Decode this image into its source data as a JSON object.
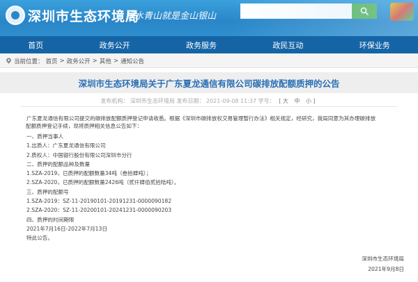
{
  "header": {
    "site_title": "深圳市生态环境局",
    "slogan": "绿水青山就是金山银山",
    "search_placeholder": "",
    "search_icon": "search-icon"
  },
  "nav": {
    "items": [
      {
        "label": "首页"
      },
      {
        "label": "政务公开"
      },
      {
        "label": "政务服务"
      },
      {
        "label": "政民互动"
      },
      {
        "label": "环保业务"
      }
    ]
  },
  "breadcrumb": {
    "prefix": "当前位置：",
    "items": [
      "首页",
      "政务公开",
      "其他",
      "通知公告"
    ],
    "sep": ">"
  },
  "article": {
    "title": "深圳市生态环境局关于广东夏龙通信有限公司碳排放配额质押的公告",
    "meta_text": "发布机构：  深圳市生态环境局  发布日期：  2021-09-08 11:37  字号：",
    "font_sizes": [
      "[ 大",
      "中",
      "小 ]"
    ],
    "intro_lines": [
      "广东夏龙通信有限公司提交的碳排放配额质押登记申请收悉。根据《深圳市碳排放权交易管理暂行办法》相关规定，经研究，我局同意为其办理碳排放",
      "配额质押登记手续，现将质押相关信息公告如下："
    ],
    "lines": [
      "一、质押当事人",
      "1.出质人：广东夏龙通信有限公司",
      "2.质权人：中国银行股份有限公司深圳市分行",
      "二、质押的配额品种及数量",
      "1.SZA-2019，已质押的配额数量34吨（叁拾肆吨）；",
      "2.SZA-2020，已质押的配额数量2426吨（贰仟肆佰贰拾陆吨）。",
      "三、质押的配额号",
      "1.SZA-2019：SZ-11-20190101-20191231-0000090182",
      "2.SZA-2020：SZ-11-20200101-20241231-0000090203",
      "四、质押的时间期限",
      "2021年7月16日-2022年7月13日",
      "特此公告。"
    ],
    "signer": "深圳市生态环境局",
    "sign_date": "2021年9月8日"
  }
}
